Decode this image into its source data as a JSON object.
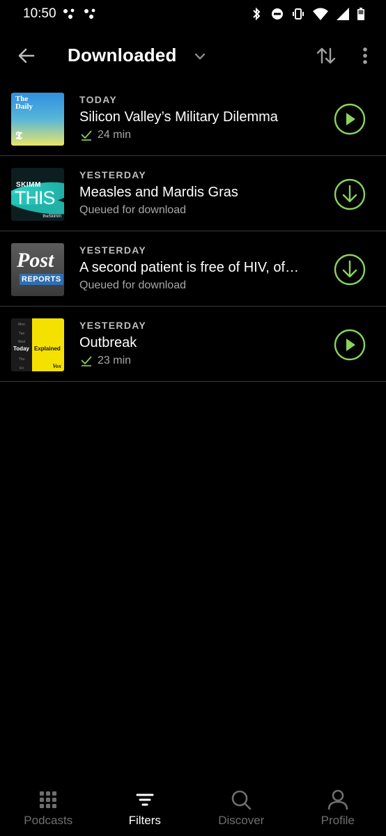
{
  "status_bar": {
    "time": "10:50"
  },
  "toolbar": {
    "title": "Downloaded"
  },
  "colors": {
    "accent": "#8bd45b",
    "background": "#000000",
    "divider": "#3a3a3a"
  },
  "episodes": [
    {
      "date": "TODAY",
      "title": "Silicon Valley’s Military Dilemma",
      "subtitle": "24 min",
      "downloaded": true,
      "action_icon": "play-icon",
      "art": {
        "title_line1": "The",
        "title_line2": "Daily",
        "mark": "𝕿"
      }
    },
    {
      "date": "YESTERDAY",
      "title": "Measles and Mardis Gras",
      "subtitle": "Queued for download",
      "downloaded": false,
      "action_icon": "download-icon",
      "art": {
        "line1": "SKIMM",
        "line2": "THIS",
        "byline": "theSkimm"
      }
    },
    {
      "date": "YESTERDAY",
      "title": "A second patient is free of HIV, of…",
      "subtitle": "Queued for download",
      "downloaded": false,
      "action_icon": "download-icon",
      "art": {
        "line1": "Post",
        "line2": "REPORTS"
      }
    },
    {
      "date": "YESTERDAY",
      "title": "Outbreak",
      "subtitle": "23 min",
      "downloaded": true,
      "action_icon": "play-icon",
      "art": {
        "days": "Mon\nTue\nWed\n\nThu\nFri",
        "word1": "Today",
        "word2": "Explained",
        "brand": "Vox"
      }
    }
  ],
  "bottom_nav": [
    {
      "label": "Podcasts",
      "icon": "grid-icon",
      "active": false
    },
    {
      "label": "Filters",
      "icon": "filter-icon",
      "active": true
    },
    {
      "label": "Discover",
      "icon": "search-icon",
      "active": false
    },
    {
      "label": "Profile",
      "icon": "profile-icon",
      "active": false
    }
  ]
}
